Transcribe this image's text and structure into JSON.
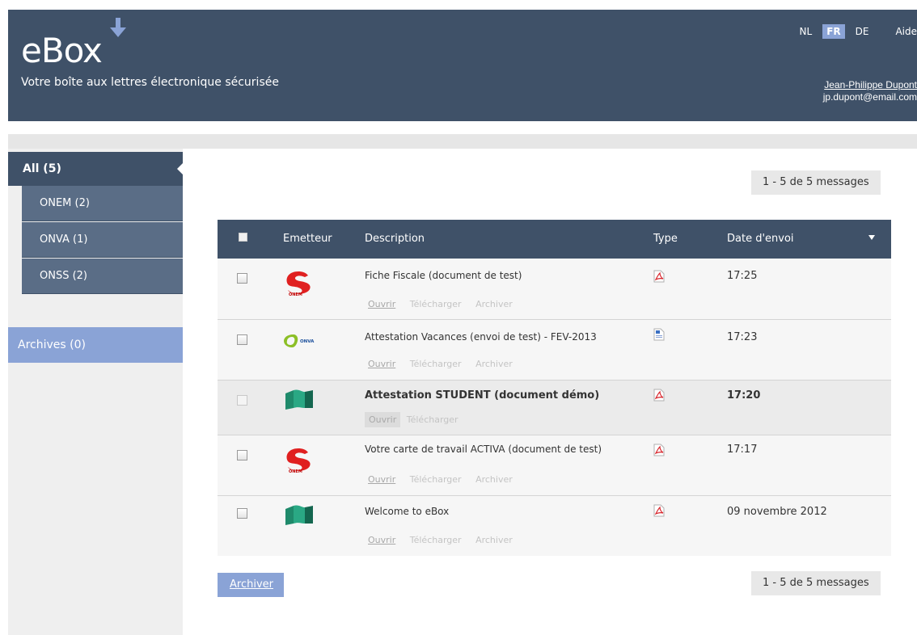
{
  "header": {
    "logo": "eBox",
    "tagline": "Votre boîte aux lettres électronique sécurisée",
    "languages": [
      "NL",
      "FR",
      "DE"
    ],
    "active_language": "FR",
    "help": "Aide",
    "user_name": "Jean-Philippe Dupont",
    "user_email": "jp.dupont@email.com"
  },
  "sidebar": {
    "all": "All (5)",
    "items": [
      {
        "label": "ONEM (2)"
      },
      {
        "label": "ONVA (1)"
      },
      {
        "label": "ONSS (2)"
      }
    ],
    "archives": "Archives (0)"
  },
  "pager": "1 - 5 de 5 messages",
  "table": {
    "headers": {
      "sender": "Emetteur",
      "description": "Description",
      "type": "Type",
      "date": "Date d'envoi"
    },
    "actions": {
      "open": "Ouvrir",
      "download": "Télécharger",
      "archive": "Archiver"
    },
    "rows": [
      {
        "sender": "onem-logo",
        "description": "Fiche Fiscale (document de test)",
        "type": "pdf-icon",
        "date": "17:25"
      },
      {
        "sender": "onva-logo",
        "description": "Attestation Vacances (envoi de test) - FEV-2013",
        "type": "document-icon",
        "date": "17:23"
      },
      {
        "sender": "onss-logo",
        "description": "Attestation STUDENT (document démo)",
        "type": "pdf-icon",
        "date": "17:20"
      },
      {
        "sender": "onem-logo",
        "description": "Votre carte de travail ACTIVA (document de test)",
        "type": "pdf-icon",
        "date": "17:17"
      },
      {
        "sender": "onss-logo",
        "description": "Welcome to eBox",
        "type": "pdf-icon",
        "date": "09 novembre 2012"
      }
    ]
  },
  "footer": {
    "archive_button": "Archiver"
  },
  "colors": {
    "header_bg": "#3f5168",
    "accent_blue": "#8aa3d6",
    "sidebar_sub": "#5a6d86"
  }
}
